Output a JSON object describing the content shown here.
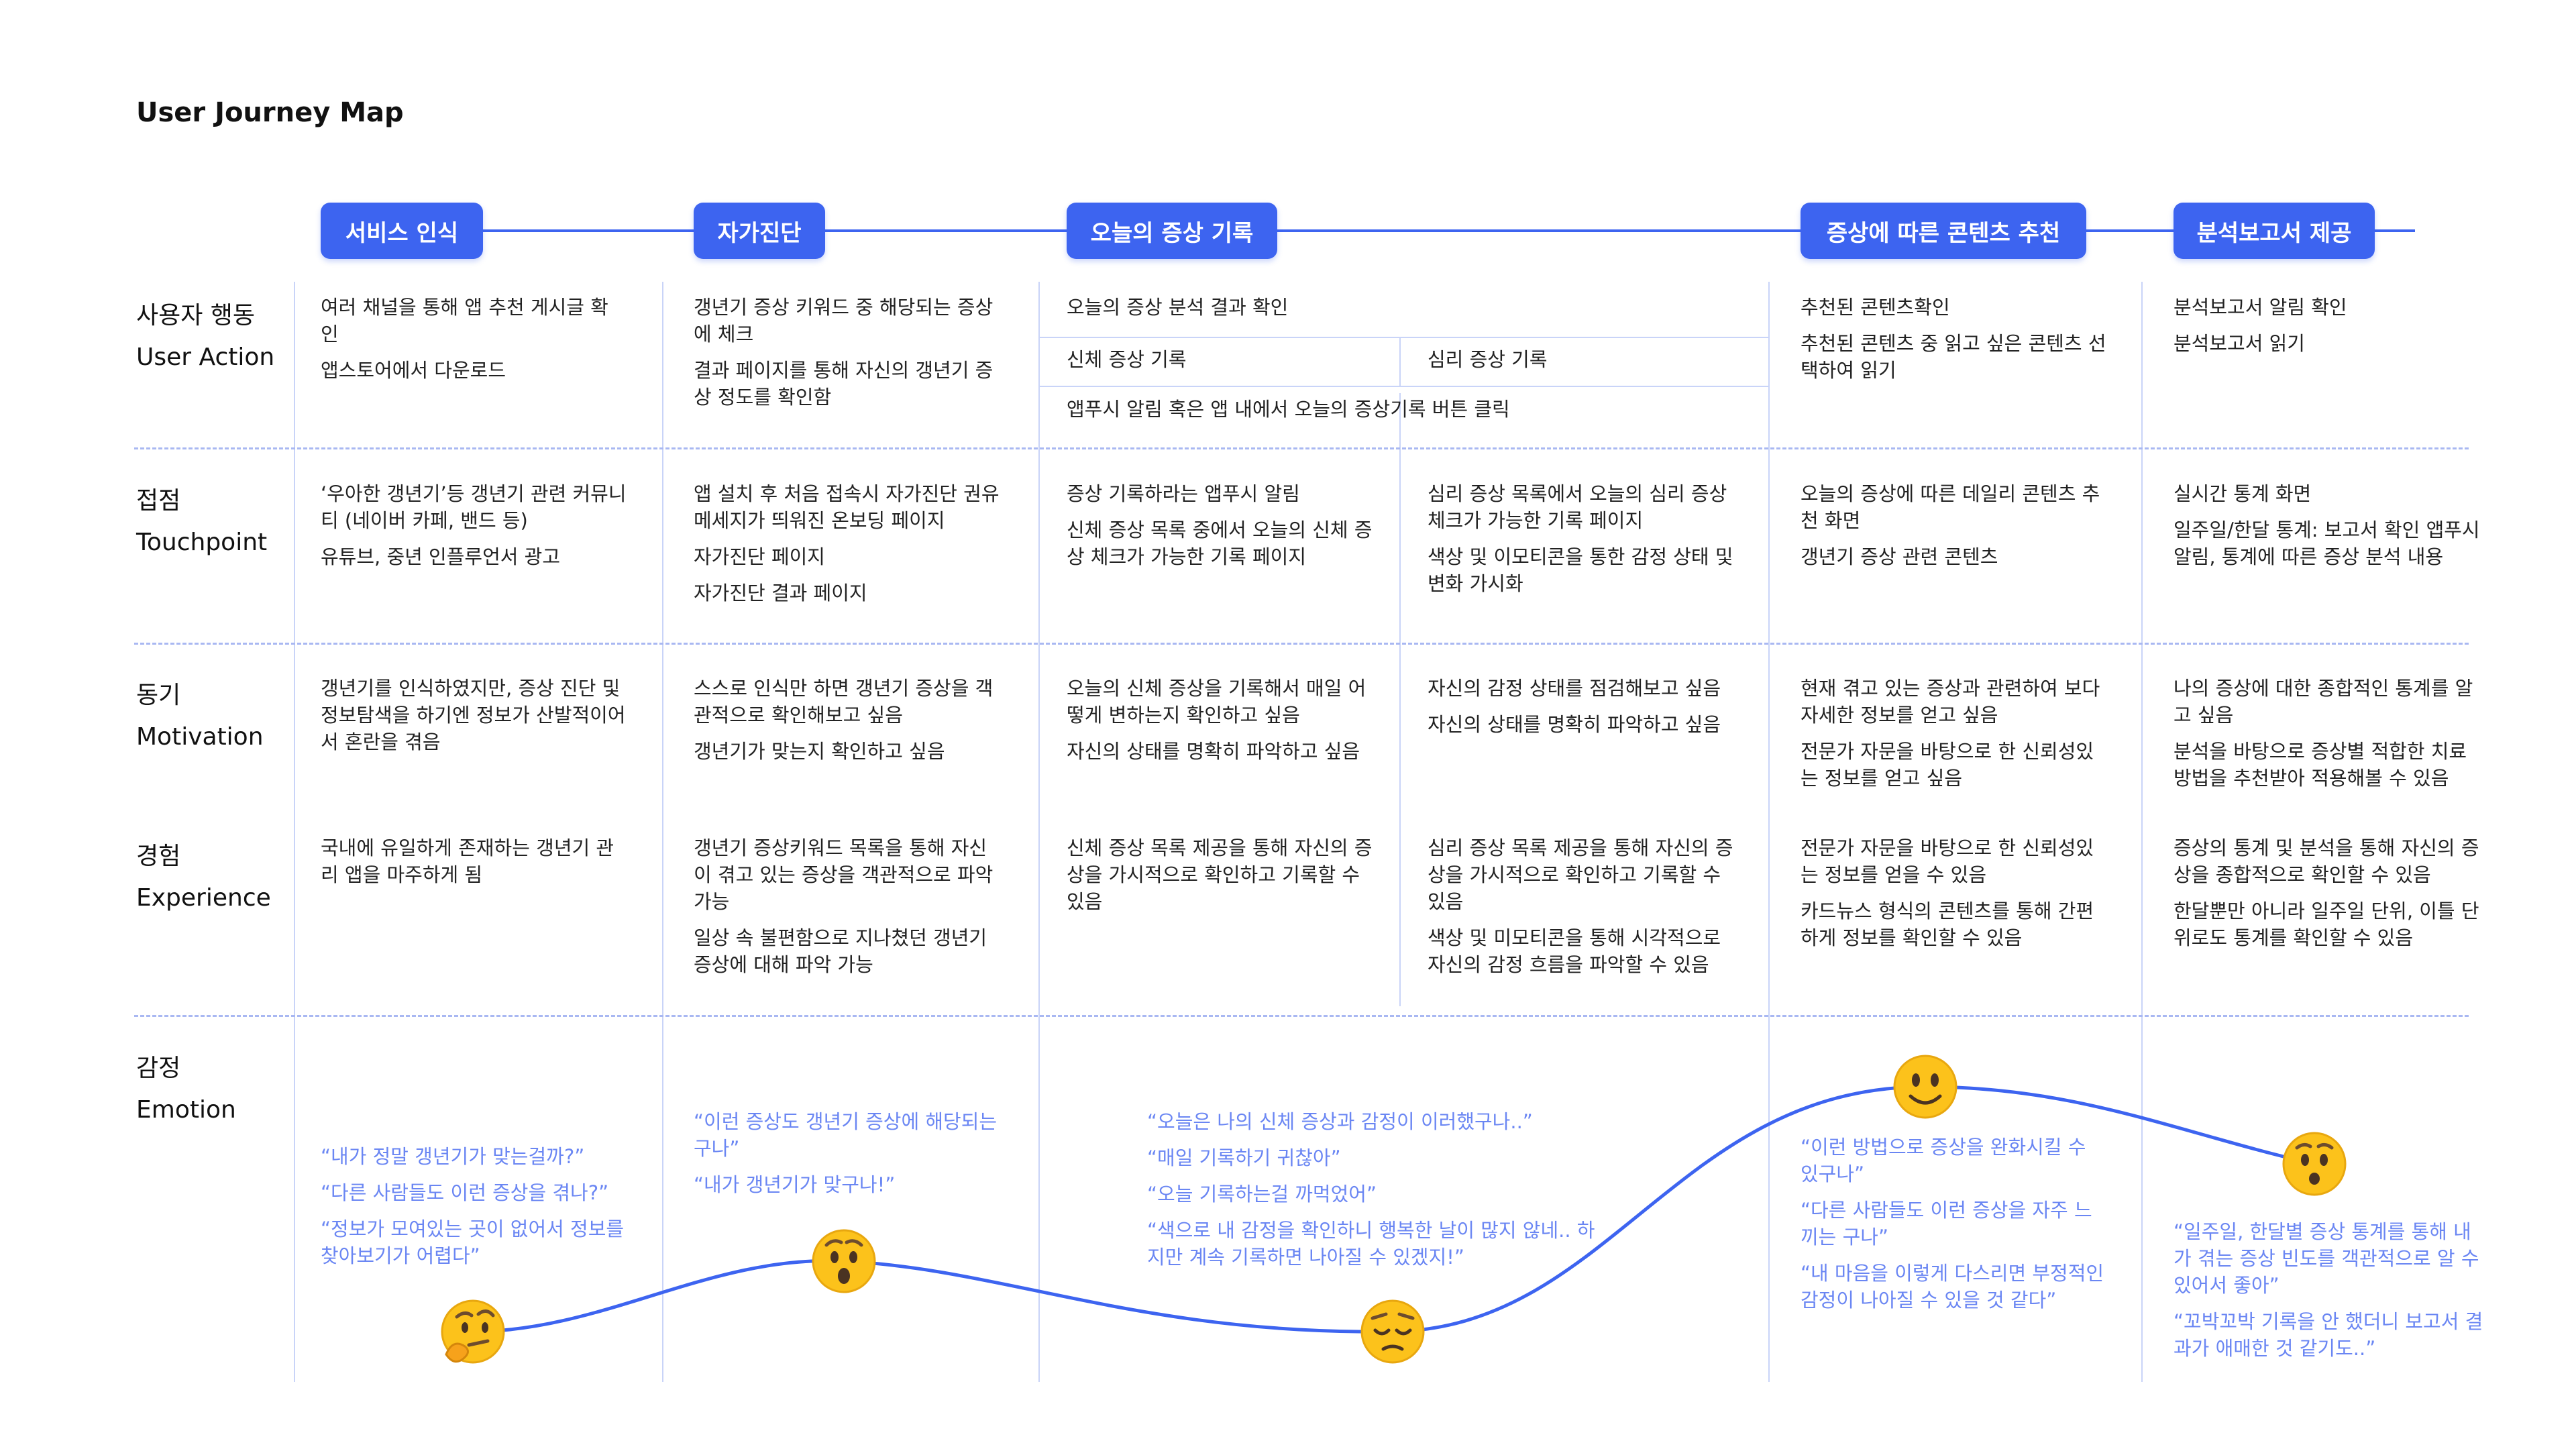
{
  "title": "User Journey Map",
  "colors": {
    "accent": "#3d64f0",
    "quote": "#6a86f3",
    "divider": "#a9b8f2"
  },
  "phases": [
    "서비스 인식",
    "자가진단",
    "오늘의 증상 기록",
    "증상에 따른 콘텐츠 추천",
    "분석보고서 제공"
  ],
  "rows": {
    "action": {
      "ko": "사용자 행동",
      "en": "User Action"
    },
    "touchpoint": {
      "ko": "접점",
      "en": "Touchpoint"
    },
    "motivation": {
      "ko": "동기",
      "en": "Motivation"
    },
    "experience": {
      "ko": "경험",
      "en": "Experience"
    },
    "emotion": {
      "ko": "감정",
      "en": "Emotion"
    }
  },
  "action": {
    "c1": [
      "여러 채널을 통해 앱 추천 게시글 확인",
      "앱스토어에서 다운로드"
    ],
    "c2": [
      "갱년기 증상 키워드 중 해당되는 증상에 체크",
      "결과 페이지를 통해 자신의 갱년기 증상 정도를 확인함"
    ],
    "c3_top": "오늘의 증상 분석 결과 확인",
    "c3_left": "신체 증상 기록",
    "c3_right": "심리 증상 기록",
    "c3_bottom": "앱푸시 알림 혹은 앱 내에서 오늘의 증상기록 버튼 클릭",
    "c4": [
      "추천된 콘텐츠확인",
      "추천된 콘텐츠 중 읽고 싶은 콘텐츠 선택하여 읽기"
    ],
    "c5": [
      "분석보고서 알림 확인",
      "분석보고서 읽기"
    ]
  },
  "touchpoint": {
    "c1": [
      "‘우아한 갱년기’등 갱년기 관련 커뮤니티 (네이버 카페, 밴드 등)",
      "유튜브, 중년 인플루언서 광고"
    ],
    "c2": [
      "앱 설치 후 처음 접속시 자가진단 권유 메세지가 띄워진 온보딩 페이지",
      "자가진단 페이지",
      "자가진단 결과 페이지"
    ],
    "c3a": [
      "증상 기록하라는 앱푸시 알림",
      "신체 증상 목록 중에서 오늘의 신체 증상 체크가 가능한 기록 페이지"
    ],
    "c3b": [
      "심리 증상 목록에서 오늘의 심리 증상 체크가 가능한 기록 페이지",
      "색상 및 이모티콘을 통한 감정 상태 및 변화 가시화"
    ],
    "c4": [
      "오늘의 증상에 따른 데일리 콘텐츠 추천 화면",
      "갱년기 증상 관련 콘텐츠"
    ],
    "c5": [
      "실시간 통계 화면",
      "일주일/한달 통계: 보고서 확인 앱푸시 알림, 통계에 따른 증상 분석 내용"
    ]
  },
  "motivation": {
    "c1": [
      "갱년기를 인식하였지만, 증상 진단 및 정보탐색을 하기엔 정보가 산발적이어서 혼란을 겪음"
    ],
    "c2": [
      "스스로 인식만 하면 갱년기 증상을 객관적으로 확인해보고 싶음",
      "갱년기가 맞는지 확인하고 싶음"
    ],
    "c3a": [
      "오늘의 신체 증상을 기록해서 매일 어떻게 변하는지 확인하고 싶음",
      "자신의 상태를 명확히 파악하고 싶음"
    ],
    "c3b": [
      "자신의 감정 상태를 점검해보고 싶음",
      "자신의 상태를 명확히 파악하고 싶음"
    ],
    "c4": [
      "현재 겪고 있는 증상과 관련하여 보다 자세한 정보를 얻고 싶음",
      "전문가 자문을 바탕으로 한 신뢰성있는 정보를 얻고 싶음"
    ],
    "c5": [
      "나의 증상에 대한 종합적인 통계를 알고 싶음",
      "분석을 바탕으로 증상별 적합한 치료 방법을 추천받아 적용해볼 수 있음"
    ]
  },
  "experience": {
    "c1": [
      "국내에 유일하게 존재하는 갱년기 관리 앱을 마주하게 됨"
    ],
    "c2": [
      "갱년기 증상키워드 목록을 통해 자신이 겪고 있는 증상을 객관적으로 파악 가능",
      "일상 속 불편함으로 지나쳤던 갱년기 증상에 대해 파악 가능"
    ],
    "c3a": [
      "신체 증상 목록 제공을 통해 자신의 증상을 가시적으로 확인하고 기록할 수 있음"
    ],
    "c3b": [
      "심리 증상 목록 제공을 통해 자신의 증상을 가시적으로 확인하고 기록할 수 있음",
      "색상 및 미모티콘을 통해 시각적으로 자신의 감정 흐름을 파악할 수 있음"
    ],
    "c4": [
      "전문가 자문을 바탕으로 한 신뢰성있는 정보를 얻을 수 있음",
      "카드뉴스 형식의 콘텐츠를 통해 간편하게 정보를 확인할 수 있음"
    ],
    "c5": [
      "증상의 통계 및 분석을 통해 자신의 증상을 종합적으로 확인할 수 있음",
      "한달뿐만 아니라 일주일 단위, 이틀 단위로도 통계를 확인할 수 있음"
    ]
  },
  "emotion": {
    "q1": [
      "“내가 정말 갱년기가 맞는걸까?”",
      "“다른 사람들도 이런 증상을 겪나?”",
      "“정보가 모여있는 곳이 없어서 정보를 찾아보기가 어렵다”"
    ],
    "q2": [
      "“이런 증상도 갱년기 증상에 해당되는구나”",
      "“내가 갱년기가 맞구나!”"
    ],
    "q3": [
      "“오늘은 나의 신체 증상과 감정이 이러했구나..”",
      "“매일 기록하기 귀찮아”",
      "“오늘 기록하는걸 까먹었어”",
      "“색으로 내 감정을 확인하니 행복한 날이 많지 않네.. 하지만 계속 기록하면 나아질 수 있겠지!”"
    ],
    "q4": [
      "“이런 방법으로 증상을 완화시킬 수 있구나”",
      "“다른 사람들도 이런 증상을 자주 느끼는 구나”",
      "“내 마음을 이렇게 다스리면 부정적인 감정이 나아질 수 있을 것 같다”"
    ],
    "q5": [
      "“일주일, 한달별 증상 통계를 통해 내가 겪는 증상 빈도를 객관적으로 알 수 있어서 좋아”",
      "“꼬박꼬박 기록을 안 했더니 보고서 결과가 애매한 것 같기도..”"
    ],
    "faces": [
      "thinking-face-icon",
      "hushed-face-icon",
      "pensive-face-icon",
      "smiling-face-icon",
      "surprised-face-icon"
    ]
  }
}
